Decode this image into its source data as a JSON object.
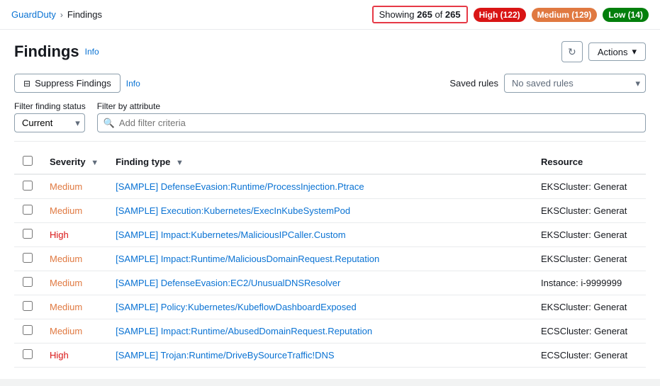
{
  "breadcrumb": {
    "parent_label": "GuardDuty",
    "separator": "›",
    "current_label": "Findings"
  },
  "showing": {
    "prefix": "Showing",
    "current": "265",
    "separator": "of",
    "total": "265"
  },
  "badges": {
    "high_label": "High (122)",
    "medium_label": "Medium (129)",
    "low_label": "Low (14)"
  },
  "page_title": "Findings",
  "info_link": "Info",
  "buttons": {
    "refresh_title": "Refresh",
    "actions_label": "Actions",
    "suppress_label": "Suppress Findings",
    "suppress_info": "Info",
    "chevron": "▾"
  },
  "saved_rules": {
    "label": "Saved rules",
    "placeholder": "No saved rules"
  },
  "filters": {
    "status_label": "Filter finding status",
    "attribute_label": "Filter by attribute",
    "status_value": "Current",
    "input_placeholder": "Add filter criteria"
  },
  "table": {
    "columns": [
      {
        "id": "severity",
        "label": "Severity",
        "sortable": true
      },
      {
        "id": "finding_type",
        "label": "Finding type",
        "sortable": true
      },
      {
        "id": "resource",
        "label": "Resource",
        "sortable": false
      }
    ],
    "rows": [
      {
        "severity": "Medium",
        "severity_class": "severity-medium",
        "finding_type": "[SAMPLE] DefenseEvasion:Runtime/ProcessInjection.Ptrace",
        "resource": "EKSCluster: Generat"
      },
      {
        "severity": "Medium",
        "severity_class": "severity-medium",
        "finding_type": "[SAMPLE] Execution:Kubernetes/ExecInKubeSystemPod",
        "resource": "EKSCluster: Generat"
      },
      {
        "severity": "High",
        "severity_class": "severity-high",
        "finding_type": "[SAMPLE] Impact:Kubernetes/MaliciousIPCaller.Custom",
        "resource": "EKSCluster: Generat"
      },
      {
        "severity": "Medium",
        "severity_class": "severity-medium",
        "finding_type": "[SAMPLE] Impact:Runtime/MaliciousDomainRequest.Reputation",
        "resource": "EKSCluster: Generat"
      },
      {
        "severity": "Medium",
        "severity_class": "severity-medium",
        "finding_type": "[SAMPLE] DefenseEvasion:EC2/UnusualDNSResolver",
        "resource": "Instance: i-9999999"
      },
      {
        "severity": "Medium",
        "severity_class": "severity-medium",
        "finding_type": "[SAMPLE] Policy:Kubernetes/KubeflowDashboardExposed",
        "resource": "EKSCluster: Generat"
      },
      {
        "severity": "Medium",
        "severity_class": "severity-medium",
        "finding_type": "[SAMPLE] Impact:Runtime/AbusedDomainRequest.Reputation",
        "resource": "ECSCluster: Generat"
      },
      {
        "severity": "High",
        "severity_class": "severity-high",
        "finding_type": "[SAMPLE] Trojan:Runtime/DriveBySourceTraffic!DNS",
        "resource": "ECSCluster: Generat"
      }
    ]
  }
}
